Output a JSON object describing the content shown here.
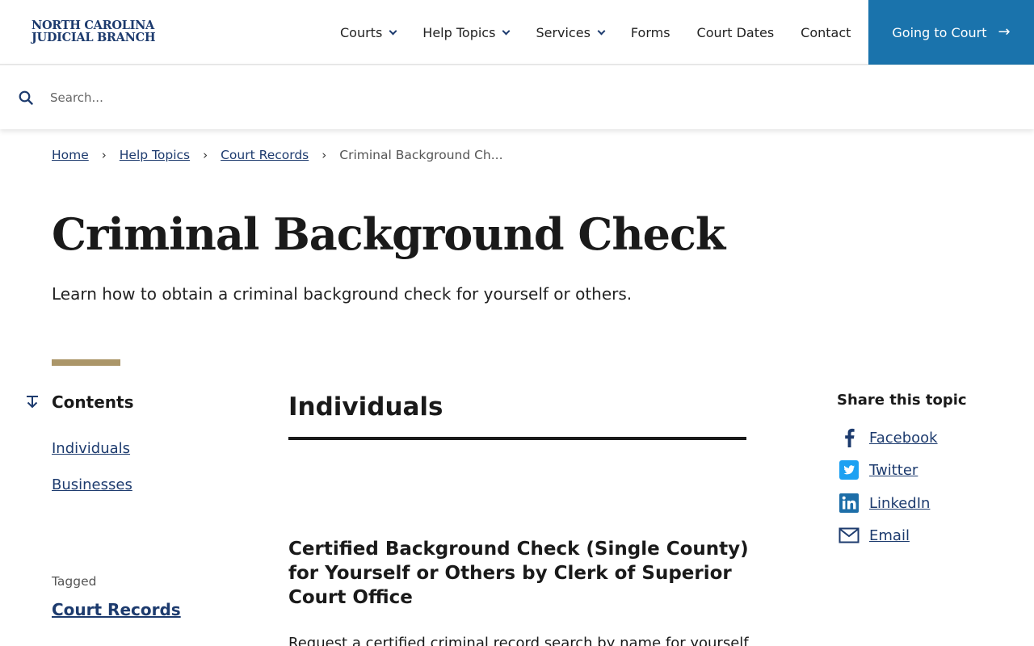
{
  "header": {
    "logo_line1": "NORTH CAROLINA",
    "logo_line2": "JUDICIAL BRANCH",
    "nav": [
      {
        "label": "Courts",
        "dropdown": true
      },
      {
        "label": "Help Topics",
        "dropdown": true
      },
      {
        "label": "Services",
        "dropdown": true
      },
      {
        "label": "Forms",
        "dropdown": false
      },
      {
        "label": "Court Dates",
        "dropdown": false
      },
      {
        "label": "Contact",
        "dropdown": false
      }
    ],
    "cta_label": "Going to Court",
    "cta_color": "#1a73ac"
  },
  "search": {
    "placeholder": "Search..."
  },
  "breadcrumb": {
    "items": [
      "Home",
      "Help Topics",
      "Court Records"
    ],
    "current": "Criminal Background Ch..."
  },
  "page": {
    "title": "Criminal Background Check",
    "subtitle": "Learn how to obtain a criminal background check for yourself or others."
  },
  "sidebar": {
    "contents_title": "Contents",
    "toc": [
      "Individuals",
      "Businesses"
    ],
    "tagged_label": "Tagged",
    "tag": "Court Records"
  },
  "main": {
    "section_heading": "Individuals",
    "article_title": "Certified Background Check (Single County) for Yourself or Others by Clerk of Superior Court Office",
    "article_text": "Request a certified criminal record search by name for yourself"
  },
  "share": {
    "title": "Share this topic",
    "items": [
      {
        "label": "Facebook",
        "icon": "facebook-icon"
      },
      {
        "label": "Twitter",
        "icon": "twitter-icon"
      },
      {
        "label": "LinkedIn",
        "icon": "linkedin-icon"
      },
      {
        "label": "Email",
        "icon": "email-icon"
      }
    ]
  },
  "colors": {
    "brand_navy": "#1d3b6e",
    "accent_gold": "#ab9669",
    "link": "#1d3b6e"
  }
}
